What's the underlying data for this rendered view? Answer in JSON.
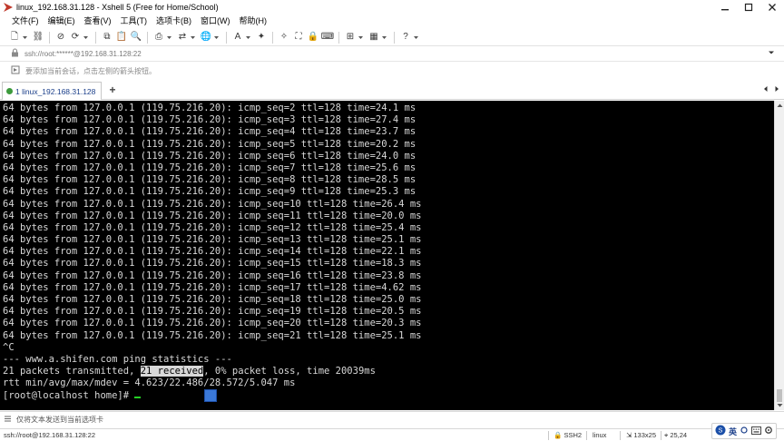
{
  "window": {
    "title": "linux_192.168.31.128 - Xshell 5 (Free for Home/School)"
  },
  "menu": [
    {
      "label": "文件(F)",
      "name": "menu-file"
    },
    {
      "label": "编辑(E)",
      "name": "menu-edit"
    },
    {
      "label": "查看(V)",
      "name": "menu-view"
    },
    {
      "label": "工具(T)",
      "name": "menu-tools"
    },
    {
      "label": "选项卡(B)",
      "name": "menu-tabs"
    },
    {
      "label": "窗口(W)",
      "name": "menu-window"
    },
    {
      "label": "帮助(H)",
      "name": "menu-help"
    }
  ],
  "toolbar": {
    "icons": [
      {
        "name": "new-session-icon",
        "glyph": "🗋",
        "caret": true
      },
      {
        "name": "link-icon",
        "glyph": "⛓",
        "caret": false
      },
      {
        "name": "disconnect-icon",
        "glyph": "⊘",
        "caret": false
      },
      {
        "name": "reconnect-icon",
        "glyph": "⟳",
        "caret": true
      },
      {
        "name": "copy-icon",
        "glyph": "⧉",
        "caret": false
      },
      {
        "name": "paste-icon",
        "glyph": "📋",
        "caret": false
      },
      {
        "name": "find-icon",
        "glyph": "🔍",
        "caret": false
      },
      {
        "name": "print-icon",
        "glyph": "⎙",
        "caret": true
      },
      {
        "name": "transfer-icon",
        "glyph": "⇄",
        "caret": true
      },
      {
        "name": "globe-icon",
        "glyph": "🌐",
        "caret": true
      },
      {
        "name": "font-icon",
        "glyph": "A",
        "caret": true
      },
      {
        "name": "xftp-icon",
        "glyph": "✦",
        "caret": false
      },
      {
        "name": "script-icon",
        "glyph": "✧",
        "caret": false
      },
      {
        "name": "fullscreen-icon",
        "glyph": "⛶",
        "caret": false
      },
      {
        "name": "lock-icon",
        "glyph": "🔒",
        "caret": false
      },
      {
        "name": "keyboard-icon",
        "glyph": "⌨",
        "caret": false
      },
      {
        "name": "compose-icon",
        "glyph": "⊞",
        "caret": true
      },
      {
        "name": "layout-icon",
        "glyph": "▦",
        "caret": true
      },
      {
        "name": "help-icon",
        "glyph": "?",
        "caret": true
      }
    ]
  },
  "address": {
    "value": "ssh://root:******@192.168.31.128:22"
  },
  "hint": {
    "text": "要添加当前会话，点击左侧的箭头按钮。"
  },
  "tabs": [
    {
      "label": "1 linux_192.168.31.128",
      "status_color": "#3c9a3c"
    }
  ],
  "terminal": {
    "lines": [
      "64 bytes from 127.0.0.1 (119.75.216.20): icmp_seq=2 ttl=128 time=24.1 ms",
      "64 bytes from 127.0.0.1 (119.75.216.20): icmp_seq=3 ttl=128 time=27.4 ms",
      "64 bytes from 127.0.0.1 (119.75.216.20): icmp_seq=4 ttl=128 time=23.7 ms",
      "64 bytes from 127.0.0.1 (119.75.216.20): icmp_seq=5 ttl=128 time=20.2 ms",
      "64 bytes from 127.0.0.1 (119.75.216.20): icmp_seq=6 ttl=128 time=24.0 ms",
      "64 bytes from 127.0.0.1 (119.75.216.20): icmp_seq=7 ttl=128 time=25.6 ms",
      "64 bytes from 127.0.0.1 (119.75.216.20): icmp_seq=8 ttl=128 time=28.5 ms",
      "64 bytes from 127.0.0.1 (119.75.216.20): icmp_seq=9 ttl=128 time=25.3 ms",
      "64 bytes from 127.0.0.1 (119.75.216.20): icmp_seq=10 ttl=128 time=26.4 ms",
      "64 bytes from 127.0.0.1 (119.75.216.20): icmp_seq=11 ttl=128 time=20.0 ms",
      "64 bytes from 127.0.0.1 (119.75.216.20): icmp_seq=12 ttl=128 time=25.4 ms",
      "64 bytes from 127.0.0.1 (119.75.216.20): icmp_seq=13 ttl=128 time=25.1 ms",
      "64 bytes from 127.0.0.1 (119.75.216.20): icmp_seq=14 ttl=128 time=22.1 ms",
      "64 bytes from 127.0.0.1 (119.75.216.20): icmp_seq=15 ttl=128 time=18.3 ms",
      "64 bytes from 127.0.0.1 (119.75.216.20): icmp_seq=16 ttl=128 time=23.8 ms",
      "64 bytes from 127.0.0.1 (119.75.216.20): icmp_seq=17 ttl=128 time=4.62 ms",
      "64 bytes from 127.0.0.1 (119.75.216.20): icmp_seq=18 ttl=128 time=25.0 ms",
      "64 bytes from 127.0.0.1 (119.75.216.20): icmp_seq=19 ttl=128 time=20.5 ms",
      "64 bytes from 127.0.0.1 (119.75.216.20): icmp_seq=20 ttl=128 time=20.3 ms",
      "64 bytes from 127.0.0.1 (119.75.216.20): icmp_seq=21 ttl=128 time=25.1 ms",
      "^C",
      "--- www.a.shifen.com ping statistics ---"
    ],
    "stats_line": {
      "before": "21 packets transmitted, ",
      "selected": "21 received",
      "after": ", 0% packet loss, time 20039ms"
    },
    "rtt_line": "rtt min/avg/max/mdev = 4.623/22.486/28.572/5.047 ms",
    "prompt": "[root@localhost home]# ",
    "fg_color": "#d8d8d8",
    "bg_color": "#000000",
    "cursor_color": "#25d025"
  },
  "sendbar": {
    "text": "仅将文本发送到当前选项卡"
  },
  "status": {
    "connection": "ssh://root@192.168.31.128:22",
    "protocol": "SSH2",
    "terminal_type": "linux",
    "size": "133x25",
    "cursor_pos": "25,24",
    "ime_mode": "英"
  }
}
